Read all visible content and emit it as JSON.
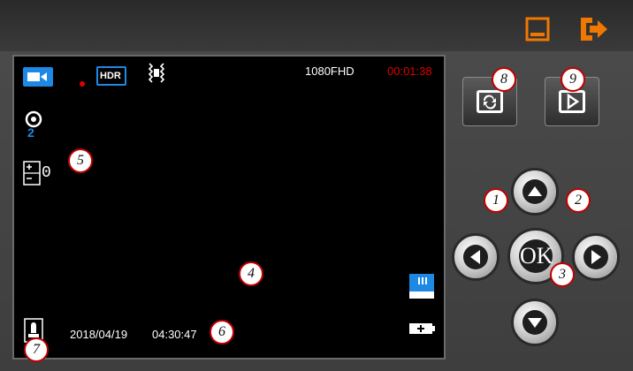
{
  "top_bar": {
    "minimize_icon": "minimize-icon",
    "exit_icon": "exit-icon",
    "accent_color": "#f07800"
  },
  "screen": {
    "resolution": "1080FHD",
    "recording_time": "00:01:38",
    "hdr_label": "HDR",
    "exposure_value": "0",
    "date": "2018/04/19",
    "time": "04:30:47",
    "icons": [
      "video-mode-icon",
      "record-dot-icon",
      "hdr-icon",
      "motion-detect-icon",
      "loop-record-icon",
      "exposure-icon",
      "sd-card-icon",
      "battery-plug-icon",
      "mic-icon"
    ],
    "recording_color": "#e00000",
    "icon_color": "#1e88e5"
  },
  "controls": {
    "ok_label": "OK",
    "buttons": [
      "switch-mode-button",
      "playback-button",
      "up-button",
      "down-button",
      "left-button",
      "right-button",
      "ok-button"
    ]
  },
  "callouts": {
    "c1": "1",
    "c2": "2",
    "c3": "3",
    "c4": "4",
    "c5": "5",
    "c6": "6",
    "c7": "7",
    "c8": "8",
    "c9": "9"
  }
}
